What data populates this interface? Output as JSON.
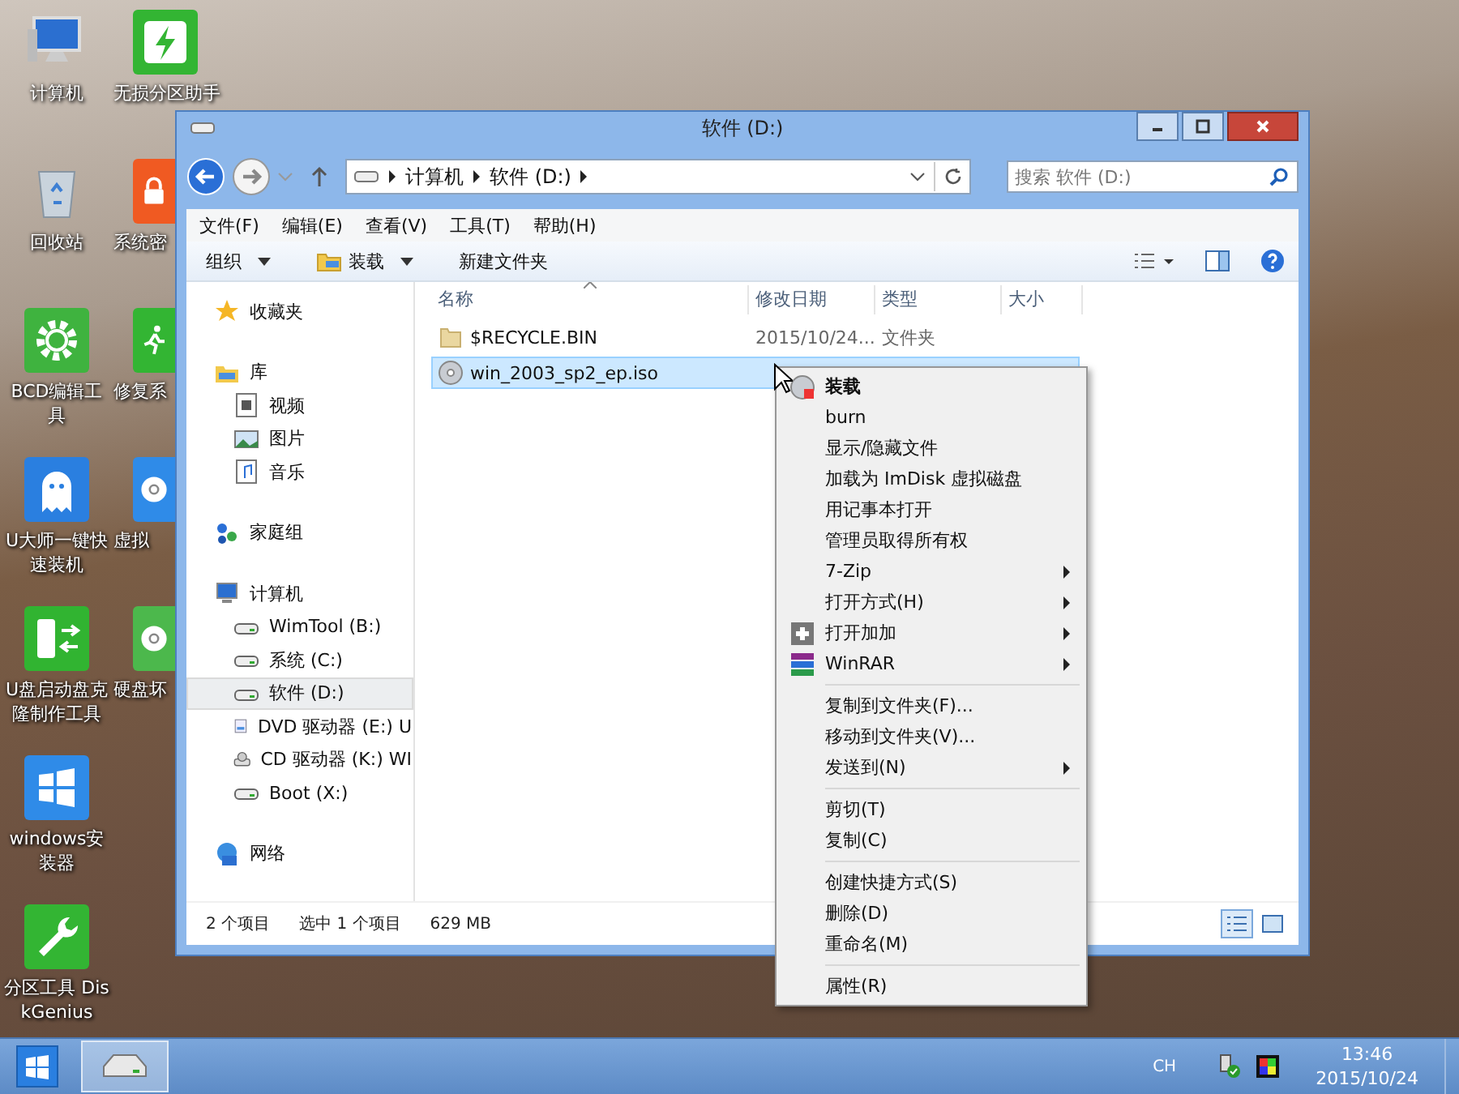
{
  "desktop": {
    "icons_left": [
      {
        "label": "计算机",
        "kind": "computer"
      },
      {
        "label": "回收站",
        "kind": "recycle"
      },
      {
        "label": "BCD编辑工具",
        "kind": "gear"
      },
      {
        "label": "U大师一键快速装机",
        "kind": "ghost"
      },
      {
        "label": "U盘启动盘克隆制作工具",
        "kind": "usb"
      },
      {
        "label": "windows安装器",
        "kind": "windows"
      },
      {
        "label": "分区工具 DiskGenius",
        "kind": "wrench"
      }
    ],
    "icons_right": [
      {
        "label": "无损分区助手",
        "kind": "bolt"
      },
      {
        "label": "系统密",
        "kind": "lock"
      },
      {
        "label": "修复系",
        "kind": "runner"
      },
      {
        "label": "虚拟",
        "kind": "disc"
      },
      {
        "label": "硬盘坏",
        "kind": "disc-green"
      }
    ]
  },
  "window": {
    "title": "软件 (D:)",
    "address": {
      "path": [
        "计算机",
        "软件 (D:)"
      ]
    },
    "search": {
      "placeholder": "搜索 软件 (D:)"
    },
    "menu": [
      "文件(F)",
      "编辑(E)",
      "查看(V)",
      "工具(T)",
      "帮助(H)"
    ],
    "toolbar": [
      {
        "label": "组织",
        "kind": "plain",
        "dropdown": true
      },
      {
        "label": "装载",
        "kind": "mount",
        "dropdown": true
      },
      {
        "label": "新建文件夹",
        "kind": "plain",
        "dropdown": false
      }
    ],
    "sidebar": {
      "groups": [
        {
          "label": "收藏夹",
          "kind": "star",
          "selected": false
        },
        {
          "label": "库",
          "kind": "library",
          "selected": false,
          "children": [
            {
              "label": "视频",
              "kind": "video",
              "selected": false
            },
            {
              "label": "图片",
              "kind": "picture",
              "selected": false
            },
            {
              "label": "音乐",
              "kind": "music",
              "selected": false
            }
          ]
        },
        {
          "label": "家庭组",
          "kind": "homegroup",
          "selected": false
        },
        {
          "label": "计算机",
          "kind": "computer",
          "selected": false,
          "children": [
            {
              "label": "WimTool (B:)",
              "kind": "drive",
              "selected": false
            },
            {
              "label": "系统 (C:)",
              "kind": "drive",
              "selected": false
            },
            {
              "label": "软件 (D:)",
              "kind": "drive",
              "selected": true
            },
            {
              "label": "DVD 驱动器 (E:) U",
              "kind": "dvd",
              "selected": false
            },
            {
              "label": "CD 驱动器 (K:) WI",
              "kind": "cd",
              "selected": false
            },
            {
              "label": "Boot (X:)",
              "kind": "drive",
              "selected": false
            }
          ]
        },
        {
          "label": "网络",
          "kind": "network",
          "selected": false
        }
      ]
    },
    "table": {
      "columns": [
        "名称",
        "修改日期",
        "类型",
        "大小"
      ],
      "rows": [
        {
          "name": "$RECYCLE.BIN",
          "kind": "folder",
          "date": "2015/10/24...",
          "type": "文件夹",
          "selected": false
        },
        {
          "name": "win_2003_sp2_ep.iso",
          "kind": "disc-image",
          "selected": true
        }
      ]
    },
    "status_bar": [
      "2 个项目",
      "选中 1 个项目",
      "629 MB"
    ],
    "views": [
      {
        "kind": "details",
        "selected": true
      },
      {
        "kind": "large-icons",
        "selected": false
      }
    ]
  },
  "context_menu": {
    "sections": [
      [
        {
          "label": "装载",
          "default": true,
          "submenu": false,
          "kind": "mount"
        },
        {
          "label": "burn",
          "default": false,
          "submenu": false
        },
        {
          "label": "显示/隐藏文件",
          "default": false,
          "submenu": false
        },
        {
          "label": "加载为 ImDisk 虚拟磁盘",
          "default": false,
          "submenu": false
        },
        {
          "label": "用记事本打开",
          "default": false,
          "submenu": false
        },
        {
          "label": "管理员取得所有权",
          "default": false,
          "submenu": false
        },
        {
          "label": "7-Zip",
          "default": false,
          "submenu": true
        },
        {
          "label": "打开方式(H)",
          "default": false,
          "submenu": true
        },
        {
          "label": "打开加加",
          "default": false,
          "submenu": true,
          "kind": "plus"
        },
        {
          "label": "WinRAR",
          "default": false,
          "submenu": true,
          "kind": "winrar"
        }
      ],
      [
        {
          "label": "复制到文件夹(F)...",
          "default": false,
          "submenu": false
        },
        {
          "label": "移动到文件夹(V)...",
          "default": false,
          "submenu": false
        },
        {
          "label": "发送到(N)",
          "default": false,
          "submenu": true
        }
      ],
      [
        {
          "label": "剪切(T)",
          "default": false,
          "submenu": false
        },
        {
          "label": "复制(C)",
          "default": false,
          "submenu": false
        }
      ],
      [
        {
          "label": "创建快捷方式(S)",
          "default": false,
          "submenu": false
        },
        {
          "label": "删除(D)",
          "default": false,
          "submenu": false
        },
        {
          "label": "重命名(M)",
          "default": false,
          "submenu": false
        }
      ],
      [
        {
          "label": "属性(R)",
          "default": false,
          "submenu": false
        }
      ]
    ]
  },
  "taskbar": {
    "tasks": [
      {
        "kind": "explorer",
        "selected": true
      }
    ],
    "language": "CH",
    "time": "13:46",
    "date": "2015/10/24"
  }
}
